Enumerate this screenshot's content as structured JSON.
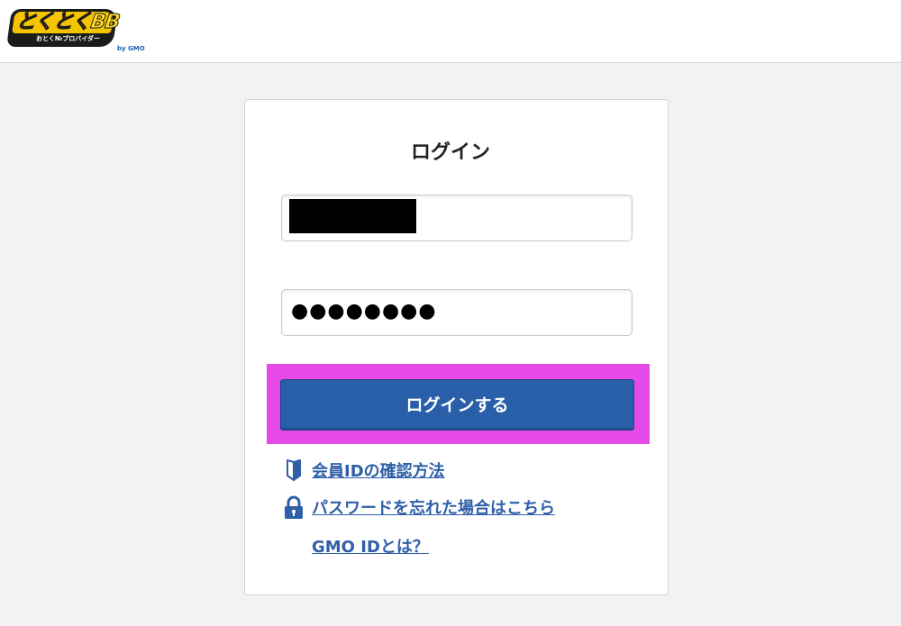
{
  "header": {
    "logo_text_main": "とくとく",
    "logo_text_bb": "BB",
    "logo_sub": "おとく№プロバイダー",
    "logo_by": "by GMO"
  },
  "login": {
    "title": "ログイン",
    "id_value": "",
    "password_mask": "●●●●●●●●",
    "submit_label": "ログインする"
  },
  "links": {
    "member_id": "会員IDの確認方法",
    "forgot_password": "パスワードを忘れた場合はこちら",
    "gmo_id": "GMO IDとは？"
  },
  "icons": {
    "beginner": "beginner-mark-icon",
    "lock": "lock-icon"
  },
  "colors": {
    "primary_button": "#295ea9",
    "link": "#2f5fa8",
    "highlight": "#e64ae8",
    "background": "#f2f2f2"
  }
}
